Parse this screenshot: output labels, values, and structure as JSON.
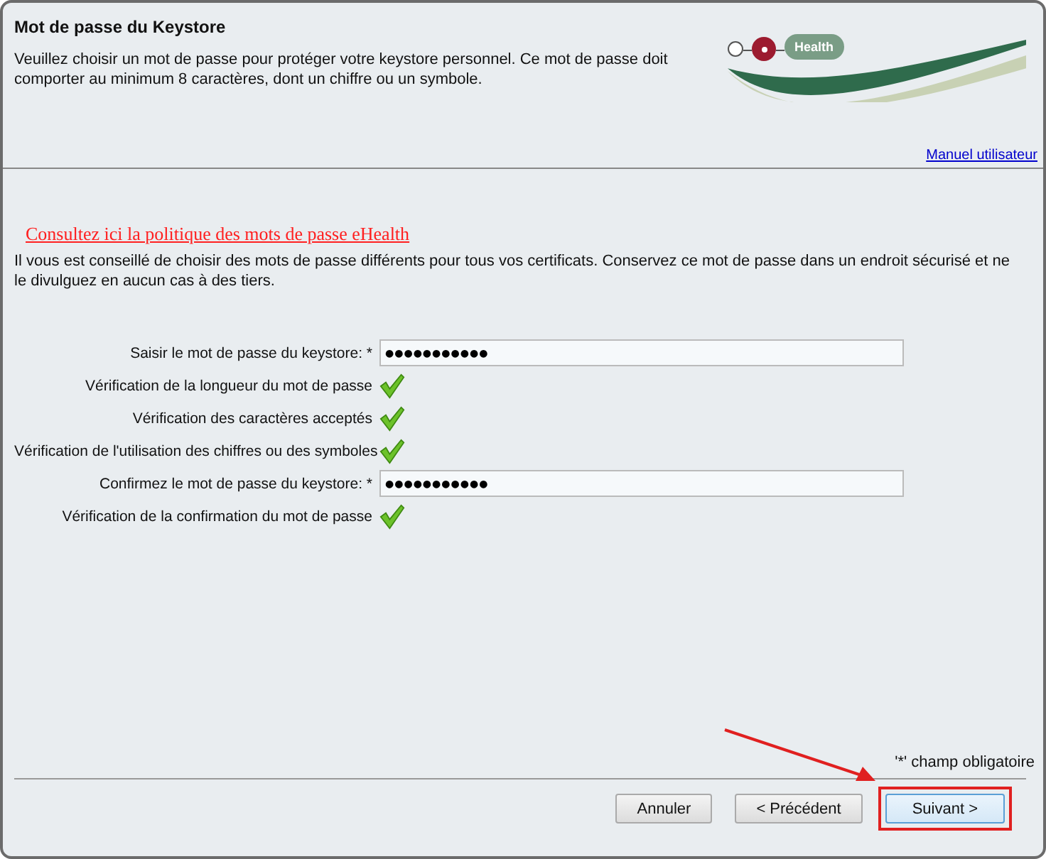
{
  "header": {
    "title": "Mot de passe du Keystore",
    "description": "Veuillez choisir un mot de passe pour protéger votre keystore personnel. Ce mot de passe doit comporter au minimum 8 caractères, dont un chiffre ou un symbole.",
    "logo_text": "Health",
    "manual_link": "Manuel utilisateur"
  },
  "policy_link": "Consultez ici la politique des mots de passe eHealth",
  "advice": "Il vous est conseillé de choisir des mots de passe différents pour tous vos certificats. Conservez ce mot de passe dans un endroit sécurisé et ne le divulguez en aucun cas à des tiers.",
  "rows": [
    {
      "kind": "password",
      "label": "Saisir le mot de passe du keystore: *",
      "value": "●●●●●●●●●●●"
    },
    {
      "kind": "check",
      "label": "Vérification de la longueur du mot de passe",
      "passed": true
    },
    {
      "kind": "check",
      "label": "Vérification des caractères acceptés",
      "passed": true
    },
    {
      "kind": "check",
      "label": "Vérification de l'utilisation des chiffres ou des symboles",
      "passed": true
    },
    {
      "kind": "password",
      "label": "Confirmez le mot de passe du keystore: *",
      "value": "●●●●●●●●●●●"
    },
    {
      "kind": "check",
      "label": "Vérification de la confirmation du mot de passe",
      "passed": true
    }
  ],
  "required_note": "'*' champ obligatoire",
  "buttons": [
    {
      "label": "Annuler",
      "highlighted": false,
      "focused": false
    },
    {
      "label": "< Précédent",
      "highlighted": false,
      "focused": false
    },
    {
      "label": "Suivant >",
      "highlighted": true,
      "focused": true
    }
  ]
}
